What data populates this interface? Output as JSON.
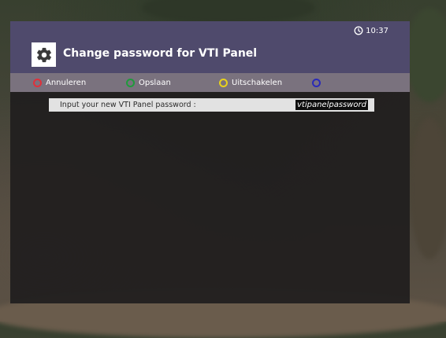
{
  "header": {
    "clock": "10:37",
    "title": "Change password for VTI Panel",
    "settings_icon": "gear-icon"
  },
  "color_keys": [
    {
      "color": "red",
      "hex": "#e0303a",
      "label": "Annuleren"
    },
    {
      "color": "green",
      "hex": "#1f9a3c",
      "label": "Opslaan"
    },
    {
      "color": "yellow",
      "hex": "#e8d21c",
      "label": "Uitschakelen"
    },
    {
      "color": "blue",
      "hex": "#2a2ab8",
      "label": ""
    }
  ],
  "config": {
    "label": "Input your new VTI Panel password :",
    "value": "vtipanelpassword"
  },
  "colors": {
    "header_bg": "#4f4a6c",
    "keybar_bg": "#7a727e",
    "panel_bg": "#201e1e",
    "row_bg": "#e2e2e2",
    "value_bg": "#0d0d0d"
  }
}
